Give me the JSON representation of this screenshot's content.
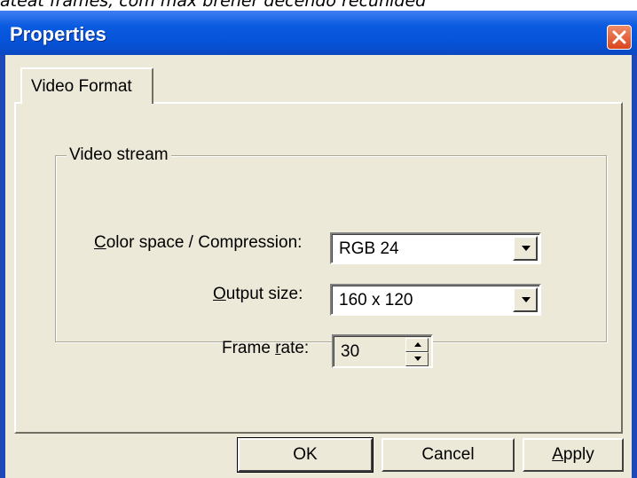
{
  "background_text": "ateat frames, com max brener decendo recunided",
  "window": {
    "title": "Properties"
  },
  "tabs": [
    {
      "label": "Video Format",
      "selected": true
    }
  ],
  "group": {
    "title": "Video stream",
    "fields": {
      "compression": {
        "label": "Color space / Compression:",
        "value": "RGB 24"
      },
      "output_size": {
        "label": "Output size:",
        "value": "160 x 120"
      },
      "frame_rate": {
        "label": "Frame rate:",
        "value": "30"
      }
    }
  },
  "buttons": {
    "ok": "OK",
    "cancel": "Cancel",
    "apply": "Apply"
  },
  "icons": {
    "close": "close-icon",
    "dropdown": "chevron-down-icon",
    "spin_up": "arrow-up-icon",
    "spin_down": "arrow-down-icon"
  },
  "colors": {
    "titlebar": "#0553d8",
    "dialog_face": "#ece9d8",
    "close_button": "#d9451e"
  }
}
